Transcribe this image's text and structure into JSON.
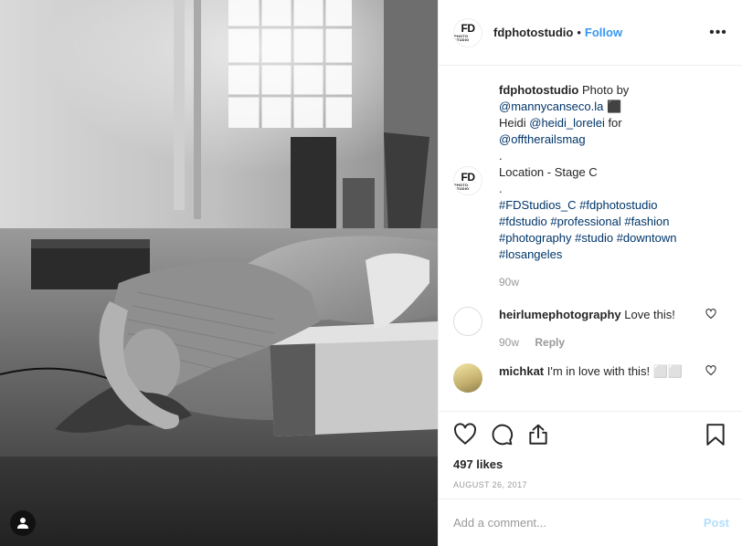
{
  "post": {
    "username": "fdphotostudio",
    "dot": "•",
    "follow_label": "Follow",
    "more_label": "•••",
    "logo": {
      "big": "FD",
      "small": "PHOTO STUDIO"
    },
    "caption": {
      "username": "fdphotostudio",
      "line1_text": "Photo by",
      "mention1": "@mannycanseco.la",
      "mention1_tail": " ⬛",
      "line2_text": "Heidi ",
      "mention2": "@heidi_lorelei",
      "line2_tail": " for",
      "mention3": "@offtherailsmag",
      "dot1": ".",
      "location": "Location - Stage C",
      "dot2": ".",
      "hashtags": [
        "#FDStudios_C",
        "#fdphotostudio",
        "#fdstudio",
        "#professional",
        "#fashion",
        "#photography",
        "#studio",
        "#downtown",
        "#losangeles"
      ],
      "time": "90w"
    },
    "comments": [
      {
        "username": "heirlumephotography",
        "text": "Love this!",
        "time": "90w",
        "reply_label": "Reply"
      },
      {
        "username": "michkat",
        "text": "I'm in love with this! ⬜⬜"
      }
    ],
    "likes": "497 likes",
    "date": "AUGUST 26, 2017",
    "add_comment_placeholder": "Add a comment...",
    "post_button": "Post"
  },
  "icons": {
    "heart": "heart-icon",
    "comment": "comment-icon",
    "share": "share-icon",
    "save": "bookmark-icon",
    "user_tag": "user-icon",
    "more": "more-horizontal-icon"
  },
  "colors": {
    "link": "#003569",
    "follow": "#3897f0",
    "muted": "#999999",
    "post_disabled": "#b2dffc",
    "text": "#262626",
    "border": "#efefef"
  }
}
